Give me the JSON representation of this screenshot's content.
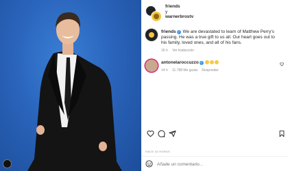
{
  "post": {
    "accounts": {
      "primary": "friends",
      "conjunction": "y",
      "secondary": "warnerbrostv"
    }
  },
  "caption": {
    "username": "friends",
    "text": " We are devastated to learn of Matthew Perry's passing. He was a true gift to us all. Our heart goes out to his family, loved ones, and all of his fans.",
    "time": "16 h",
    "translation_label": "Ver traducción"
  },
  "comment": {
    "username": "antonelaroccuzzo",
    "time": "14 h",
    "likes": "11.798 Me gusta",
    "reply_label": "Responder"
  },
  "footer": {
    "time_ago": "HACE 16 HORAS",
    "comment_placeholder": "Añade un comentario..."
  },
  "icons": {
    "like": "heart-icon",
    "comment": "comment-icon",
    "share": "share-icon",
    "save": "bookmark-icon",
    "emoji": "smiley-icon"
  },
  "colors": {
    "photo_background": "#2a64bb",
    "verified": "#3897f0",
    "story_ring": "#d62976"
  }
}
